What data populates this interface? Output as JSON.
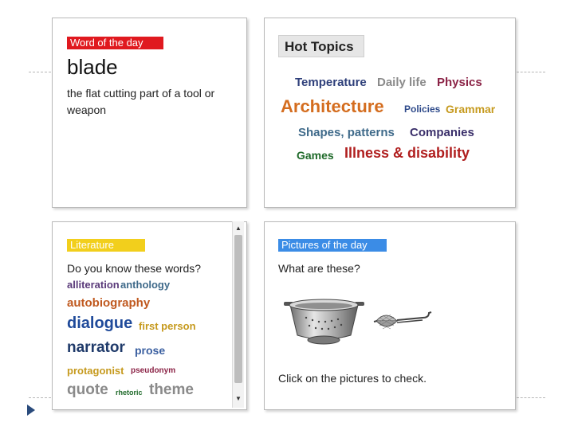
{
  "word_of_day": {
    "badge": "Word of the day",
    "word": "blade",
    "definition_line1": "the flat cutting part of a tool or",
    "definition_line2": "weapon"
  },
  "hot_topics": {
    "title": "Hot Topics",
    "tags": [
      {
        "text": "Temperature",
        "color": "#2e3f7a"
      },
      {
        "text": "Daily life",
        "color": "#8a8a8a"
      },
      {
        "text": "Physics",
        "color": "#8b2346"
      },
      {
        "text": "Architecture",
        "color": "#d46d1f"
      },
      {
        "text": "Policies",
        "color": "#2e4a8a"
      },
      {
        "text": "Grammar",
        "color": "#c69a1e"
      },
      {
        "text": "Shapes, patterns",
        "color": "#3f6a8a"
      },
      {
        "text": "Companies",
        "color": "#3a2f6a"
      },
      {
        "text": "Games",
        "color": "#1f6a2a"
      },
      {
        "text": "Illness & disability",
        "color": "#b01e1e"
      }
    ]
  },
  "literature": {
    "badge": "Literature",
    "question": "Do you know these words?",
    "words": [
      {
        "text": "alliteration",
        "color": "#5a3a7a"
      },
      {
        "text": "anthology",
        "color": "#3f6a8a"
      },
      {
        "text": "autobiography",
        "color": "#c0591f"
      },
      {
        "text": "dialogue",
        "color": "#1f4a9a"
      },
      {
        "text": "first person",
        "color": "#c69a1e"
      },
      {
        "text": "narrator",
        "color": "#1f3a6a"
      },
      {
        "text": "prose",
        "color": "#3a5fa0"
      },
      {
        "text": "protagonist",
        "color": "#c69a1e"
      },
      {
        "text": "pseudonym",
        "color": "#8b2346"
      },
      {
        "text": "quote",
        "color": "#8a8a8a"
      },
      {
        "text": "rhetoric",
        "color": "#1f6a2a"
      },
      {
        "text": "theme",
        "color": "#8a8a8a"
      }
    ]
  },
  "pictures": {
    "badge": "Pictures of the day",
    "question": "What are these?",
    "footer": "Click on the pictures to check."
  },
  "colors": {
    "word_badge": "#e0191f",
    "literature_badge": "#f2cf1c",
    "pictures_badge": "#3b8ce6"
  }
}
